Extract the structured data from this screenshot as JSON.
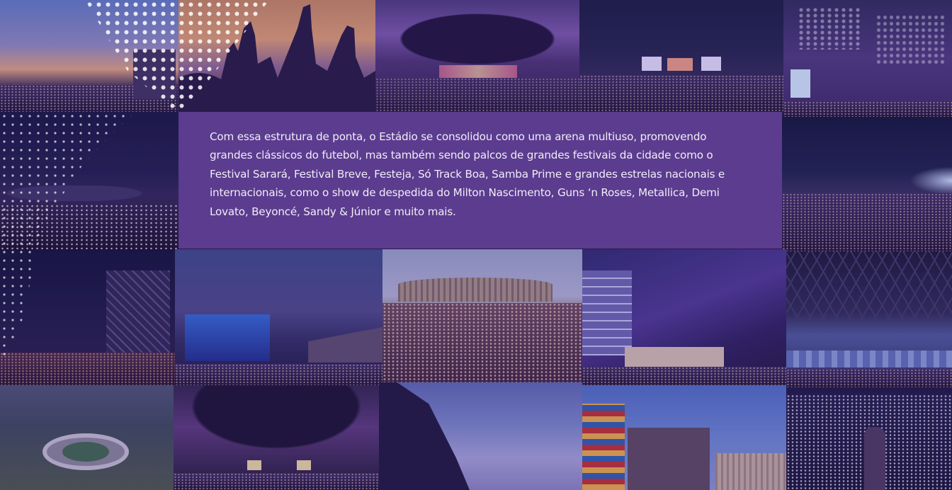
{
  "panel": {
    "text": "Com essa estrutura de ponta, o Estádio se consolidou como uma arena multiuso, promovendo grandes clássicos do futebol, mas também sendo palcos de grandes festivais da cidade como o Festival Sarará, Festival Breve, Festeja, Só Track Boa, Samba Prime e grandes estrelas nacionais e internacionais, como o show de despedida do Milton Nascimento, Guns ‘n Roses, Metallica, Demi Lovato, Beyoncé, Sandy & Júnior e muito mais."
  },
  "colors": {
    "panel": "#5b3c8e",
    "panel_text": "#f1ecf8",
    "background": "#2a1a4d"
  },
  "photos": [
    {
      "name": "photo-sunset-crowd",
      "subject": "crowd at sunset"
    },
    {
      "name": "photo-raised-hands",
      "subject": "raised hands silhouettes"
    },
    {
      "name": "photo-stadium-night-concert",
      "subject": "stadium concert at night, aerial"
    },
    {
      "name": "photo-outdoor-stage-night",
      "subject": "outdoor stages at night"
    },
    {
      "name": "photo-fireworks",
      "subject": "fireworks over stadium"
    },
    {
      "name": "photo-phone-lights-crowd",
      "subject": "crowd with phone lights"
    },
    {
      "name": "photo-festival-crowd-night",
      "subject": "festival crowd at night"
    },
    {
      "name": "photo-stage-truss",
      "subject": "stage truss and crowd"
    },
    {
      "name": "photo-blue-stage",
      "subject": "blue lit stage with stadium"
    },
    {
      "name": "photo-stadium-daytime-crowd",
      "subject": "daytime crowd in front of stadium"
    },
    {
      "name": "photo-laser-show",
      "subject": "laser show near stadium"
    },
    {
      "name": "photo-stadium-roof-interior",
      "subject": "stadium roof interior"
    },
    {
      "name": "photo-stadium-aerial",
      "subject": "stadium aerial view"
    },
    {
      "name": "photo-stadium-interior-night",
      "subject": "stadium interior night concert"
    },
    {
      "name": "photo-stadium-sky",
      "subject": "stadium silhouette and sky"
    },
    {
      "name": "photo-festival-stage-day",
      "subject": "festival stage during day"
    },
    {
      "name": "photo-performer-stage",
      "subject": "performer on stage"
    }
  ]
}
